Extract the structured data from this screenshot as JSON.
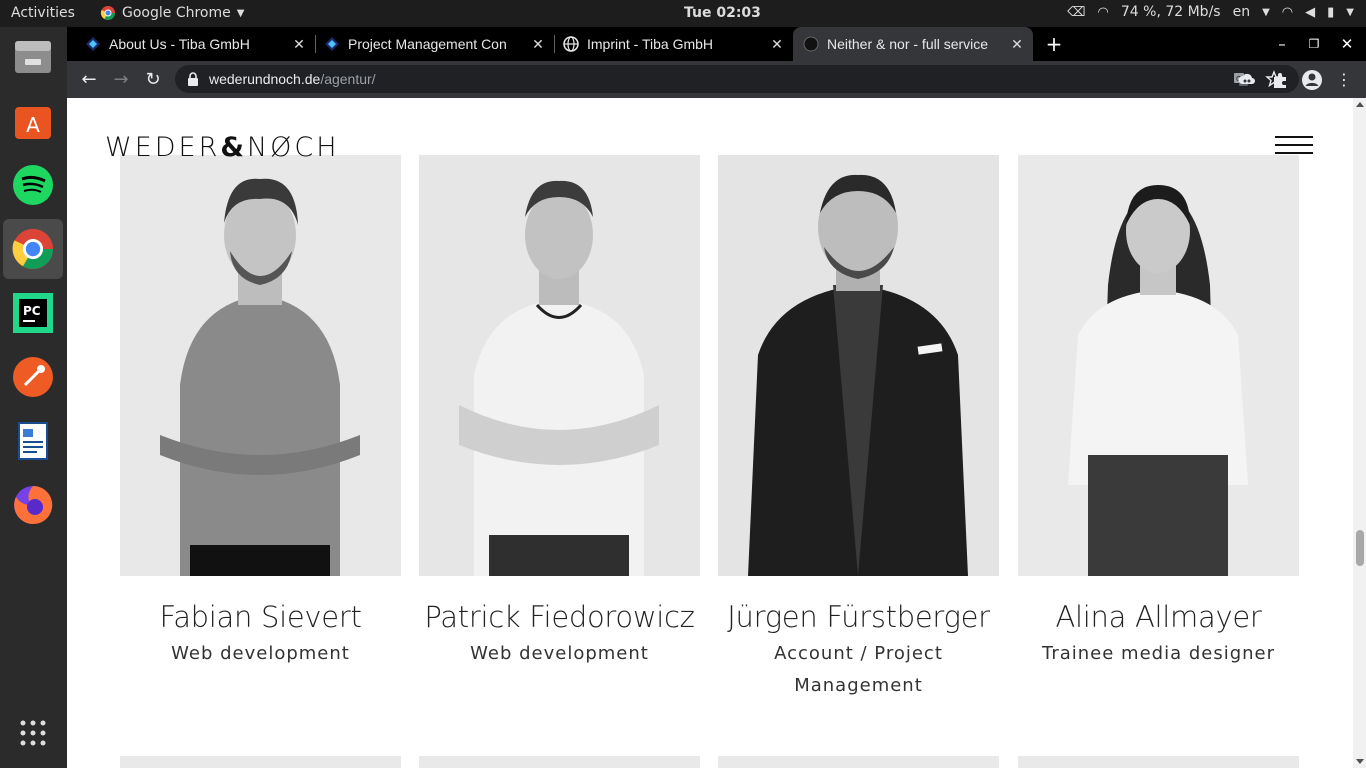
{
  "system": {
    "activities": "Activities",
    "app_name": "Google Chrome",
    "clock": "Tue 02:03",
    "status": "74 %, 72 Mb/s",
    "lang": "en"
  },
  "browser": {
    "tabs": [
      {
        "title": "About Us - Tiba GmbH"
      },
      {
        "title": "Project Management Con"
      },
      {
        "title": "Imprint - Tiba GmbH"
      },
      {
        "title": "Neither & nor - full service"
      }
    ],
    "url_host": "wederundnoch.de",
    "url_path": "/agentur/"
  },
  "site": {
    "logo_left": "WEDER",
    "logo_amp": "&",
    "logo_right": "NØCH"
  },
  "team": [
    {
      "name": "Fabian Sievert",
      "role": "Web development"
    },
    {
      "name": "Patrick Fiedorowicz",
      "role": "Web development"
    },
    {
      "name": "Jürgen Fürstberger",
      "role": "Account / Project Management"
    },
    {
      "name": "Alina Allmayer",
      "role": "Trainee media designer"
    }
  ],
  "colors": {
    "page_bg": "#ffffff",
    "text": "#222222",
    "chrome_dark": "#35363a",
    "tab_strip": "#000000"
  }
}
